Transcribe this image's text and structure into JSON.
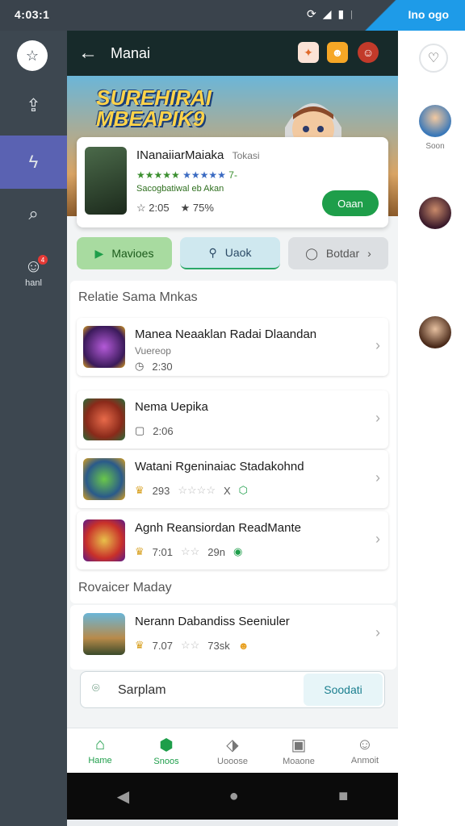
{
  "status_bar": {
    "time": "4:03:1",
    "right_text": "Ino ogo",
    "icons": [
      "sync-icon",
      "wifi-icon",
      "signal-icon",
      "battery-icon"
    ]
  },
  "left_rail": {
    "items": [
      {
        "name": "rail-home",
        "icon": "star-icon"
      },
      {
        "name": "rail-share",
        "icon": "share-icon"
      },
      {
        "name": "rail-alerts",
        "icon": "bolt-icon",
        "active": true
      },
      {
        "name": "rail-search",
        "icon": "search-icon"
      },
      {
        "name": "rail-chat",
        "icon": "chat-icon",
        "label": "hanl",
        "badge": "4"
      }
    ]
  },
  "right_rail": {
    "people": [
      {
        "name": "Soon"
      },
      {
        "name": ""
      },
      {
        "name": ""
      }
    ]
  },
  "header": {
    "title": "Manai",
    "back": "←"
  },
  "banner": {
    "title_line1": "SUREHIRAI",
    "title_line2": "MBEAPIK9"
  },
  "featured_app": {
    "name": "INanaiiarMaiaka",
    "tag": "Tokasi",
    "rating_text": "7-",
    "subtitle": "Sacogbatiwal eb Akan",
    "stat1": "2:05",
    "stat2": "75%",
    "open_label": "Oaan"
  },
  "chips": [
    {
      "label": "Mavioes"
    },
    {
      "label": "Uaok"
    },
    {
      "label": "Botdar"
    }
  ],
  "section1": {
    "title": "Relatie Sama Mnkas"
  },
  "list": [
    {
      "name": "Manea Neaaklan Radai Dlaandan",
      "sub": "Vuereop",
      "meta": "2:30"
    },
    {
      "name": "Nema Uepika",
      "sub": "",
      "meta": "2:06"
    },
    {
      "name": "Watani Rgeninaiac Stadakohnd",
      "sub": "",
      "meta": "293",
      "extra": "X"
    },
    {
      "name": "Agnh Reansiordan ReadMante",
      "sub": "",
      "meta": "7:01",
      "extra": "29n"
    }
  ],
  "section2": {
    "title": "Rovaicer Maday"
  },
  "list2": [
    {
      "name": "Nerann Dabandiss Seeniuler",
      "meta": "7.07",
      "extra": "73sk"
    }
  ],
  "search": {
    "placeholder": "Sarplam",
    "button": "Soodati"
  },
  "bottom_nav": [
    {
      "label": "Hame",
      "icon": "home-icon",
      "active": true
    },
    {
      "label": "Snoos",
      "icon": "tag-icon"
    },
    {
      "label": "Uooose",
      "icon": "trend-icon"
    },
    {
      "label": "Moaone",
      "icon": "inbox-icon"
    },
    {
      "label": "Anmoit",
      "icon": "person-icon"
    }
  ],
  "colors": {
    "accent": "#1e9e4a",
    "header": "#172a2a",
    "rail": "#3d4750",
    "rail_active": "#5a62b2"
  }
}
